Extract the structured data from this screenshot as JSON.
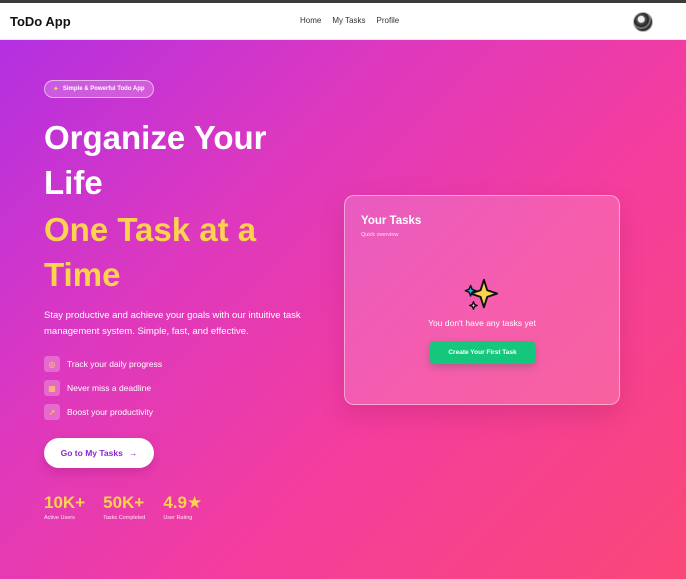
{
  "navbar": {
    "brand": "ToDo App",
    "links": [
      "Home",
      "My Tasks",
      "Profile"
    ],
    "avatar_icon": "user-avatar"
  },
  "hero": {
    "badge": "Simple & Powerful Todo App",
    "badge_icon": "rocket-icon",
    "headline_white": "Organize Your Life",
    "headline_yellow": "One Task at a Time",
    "description": "Stay productive and achieve your goals with our intuitive task management system. Simple, fast, and effective.",
    "features": [
      {
        "icon": "target-icon",
        "glyph": "◎",
        "text": "Track your daily progress"
      },
      {
        "icon": "calendar-icon",
        "glyph": "▦",
        "text": "Never miss a deadline"
      },
      {
        "icon": "trending-up-icon",
        "glyph": "↗",
        "text": "Boost your productivity"
      }
    ],
    "cta_label": "Go to My Tasks",
    "cta_arrow": "→",
    "stats": [
      {
        "value": "10K+",
        "label": "Active Users"
      },
      {
        "value": "50K+",
        "label": "Tasks Completed"
      },
      {
        "value": "4.9★",
        "label": "User Rating"
      }
    ]
  },
  "tasks_card": {
    "title": "Your Tasks",
    "subtitle": "Quick overview",
    "empty_icon": "sparkles-icon",
    "empty_message": "You don't have any tasks yet",
    "create_button": "Create Your First Task"
  },
  "colors": {
    "accent_yellow": "#fcd24e",
    "cta_text": "#8b27d6",
    "create_button": "#14c77c",
    "gradient_start": "#b330e2",
    "gradient_end": "#fa4778"
  }
}
